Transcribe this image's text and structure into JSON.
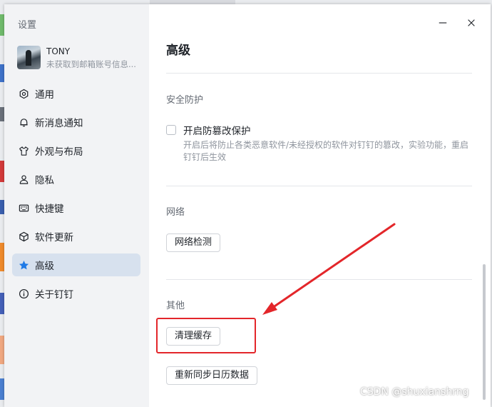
{
  "window": {
    "title": "设置"
  },
  "profile": {
    "name": "TONY",
    "subtitle": "未获取到邮箱账号信息..."
  },
  "sidebar": {
    "items": [
      {
        "label": "通用",
        "icon": "settings-circle-icon",
        "active": false
      },
      {
        "label": "新消息通知",
        "icon": "bell-icon",
        "active": false
      },
      {
        "label": "外观与布局",
        "icon": "shirt-icon",
        "active": false
      },
      {
        "label": "隐私",
        "icon": "person-icon",
        "active": false
      },
      {
        "label": "快捷键",
        "icon": "keyboard-icon",
        "active": false
      },
      {
        "label": "软件更新",
        "icon": "cube-icon",
        "active": false
      },
      {
        "label": "高级",
        "icon": "star-icon",
        "active": true
      },
      {
        "label": "关于钉钉",
        "icon": "info-icon",
        "active": false
      }
    ]
  },
  "main": {
    "title": "高级",
    "security": {
      "title": "安全防护",
      "checkbox_label": "开启防篡改保护",
      "checked": false,
      "description": "开启后将防止各类恶意软件/未经授权的软件对钉钉的篡改，实验功能，重启钉钉后生效"
    },
    "network": {
      "title": "网络",
      "button": "网络检测"
    },
    "other": {
      "title": "其他",
      "clear_cache_button": "清理缓存",
      "resync_button": "重新同步日历数据"
    }
  },
  "watermark": "CSDN @shuxianshrng",
  "colors": {
    "accent": "#1f7ae6",
    "active_bg": "#d7e1ee",
    "annotation_red": "#e3262a"
  }
}
